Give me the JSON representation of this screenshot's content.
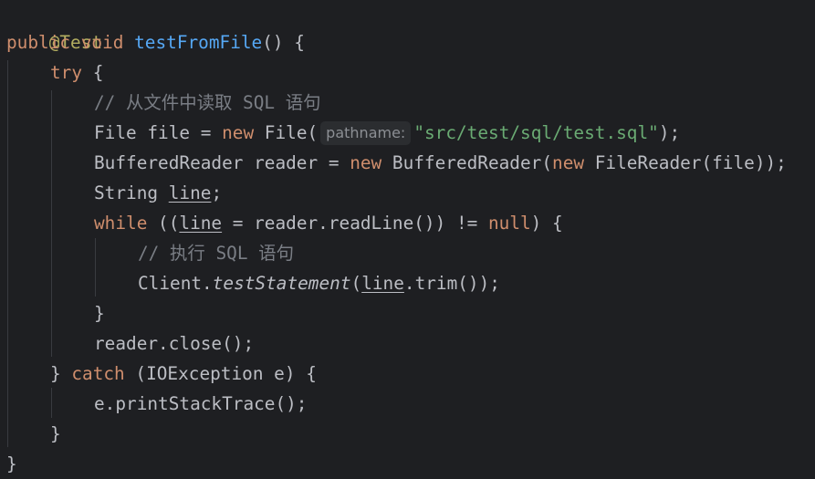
{
  "code": {
    "l1": {
      "annotation": "@Test"
    },
    "l2": {
      "kw1": "public",
      "kw2": "void",
      "method": "testFromFile",
      "rest": "() {"
    },
    "l3": {
      "kw": "try",
      "rest": " {"
    },
    "l4": {
      "comment": "// 从文件中读取 SQL 语句"
    },
    "l5": {
      "pre": "File file = ",
      "kw": "new",
      "mid": " File(",
      "hint": "pathname:",
      "str": "\"src/test/sql/test.sql\"",
      "post": ");"
    },
    "l6": {
      "pre": "BufferedReader reader = ",
      "kw1": "new",
      "mid": " BufferedReader(",
      "kw2": "new",
      "post": " FileReader(file));"
    },
    "l7": {
      "pre": "String ",
      "var": "line",
      "post": ";"
    },
    "l8": {
      "kw": "while",
      "pre": " ((",
      "var": "line",
      "mid": " = reader.readLine()) != ",
      "kw2": "null",
      "post": ") {"
    },
    "l9": {
      "comment": "// 执行 SQL 语句"
    },
    "l10": {
      "pre": "Client.",
      "method": "testStatement",
      "mid": "(",
      "var": "line",
      "post": ".trim());"
    },
    "l11": {
      "text": "}"
    },
    "l12": {
      "text": "reader.close();"
    },
    "l13": {
      "pre": "} ",
      "kw": "catch",
      "post": " (IOException e) {"
    },
    "l14": {
      "text": "e.printStackTrace();"
    },
    "l15": {
      "text": "}"
    },
    "l16": {
      "text": "}"
    }
  },
  "colors": {
    "background": "#1e1f22",
    "keyword": "#cf8e6d",
    "annotation": "#b3ae60",
    "method": "#56a8f5",
    "string": "#6aab73",
    "comment": "#7a7e85",
    "text": "#bcbec4"
  }
}
